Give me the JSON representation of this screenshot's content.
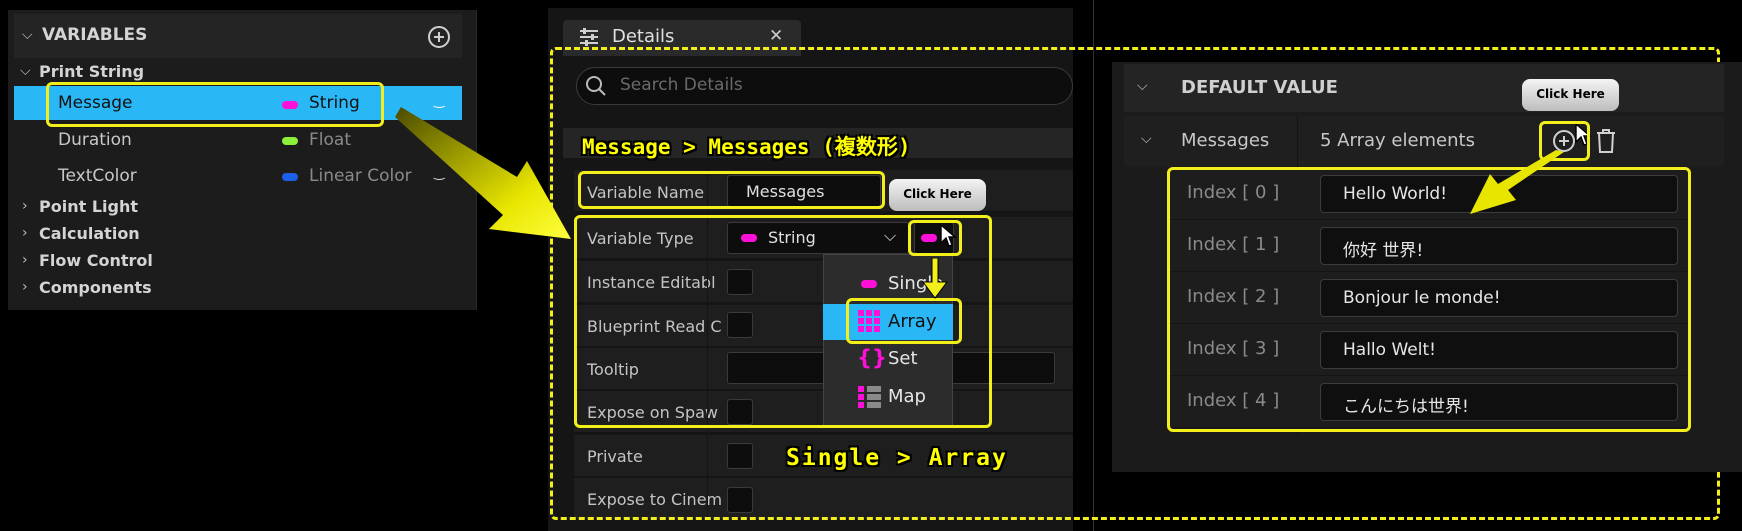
{
  "variables_panel": {
    "title": "VARIABLES",
    "category_open": "Print String",
    "variables": [
      {
        "name": "Message",
        "type": "String",
        "color": "#ff10d8"
      },
      {
        "name": "Duration",
        "type": "Float",
        "color": "#8cf03a"
      },
      {
        "name": "TextColor",
        "type": "Linear Color",
        "color": "#1d5fe8"
      }
    ],
    "categories": [
      "Point Light",
      "Calculation",
      "Flow Control",
      "Components"
    ]
  },
  "details_panel": {
    "tab_title": "Details",
    "search_placeholder": "Search Details",
    "annotation_rename": "Message > Messages (複数形)",
    "properties": {
      "variable_name_label": "Variable Name",
      "variable_name_value": "Messages",
      "variable_type_label": "Variable Type",
      "variable_type_value": "String",
      "instance_editable_label": "Instance Editabl",
      "blueprint_read_only_label": "Blueprint Read C",
      "tooltip_label": "Tooltip",
      "expose_on_spawn_label": "Expose on Spaw",
      "private_label": "Private",
      "expose_to_cinematics_label": "Expose to Cinem"
    },
    "container_menu": {
      "items": [
        "Single",
        "Array",
        "Set",
        "Map"
      ],
      "selected": "Array"
    },
    "annotation_click": "Click Here",
    "annotation_container": "Single > Array"
  },
  "default_panel": {
    "title": "DEFAULT VALUE",
    "array_name": "Messages",
    "array_count": "5 Array elements",
    "annotation_click": "Click Here",
    "elements": [
      {
        "label": "Index [ 0 ]",
        "value": "Hello World!"
      },
      {
        "label": "Index [ 1 ]",
        "value": "你好 世界!"
      },
      {
        "label": "Index [ 2 ]",
        "value": "Bonjour le monde!"
      },
      {
        "label": "Index [ 3 ]",
        "value": "Hallo Welt!"
      },
      {
        "label": "Index [ 4 ]",
        "value": "こんにちは世界!"
      }
    ]
  },
  "colors": {
    "selection": "#2ab7f6",
    "annotation_yellow": "#f2ef1a",
    "string_pin": "#ff10d8"
  }
}
